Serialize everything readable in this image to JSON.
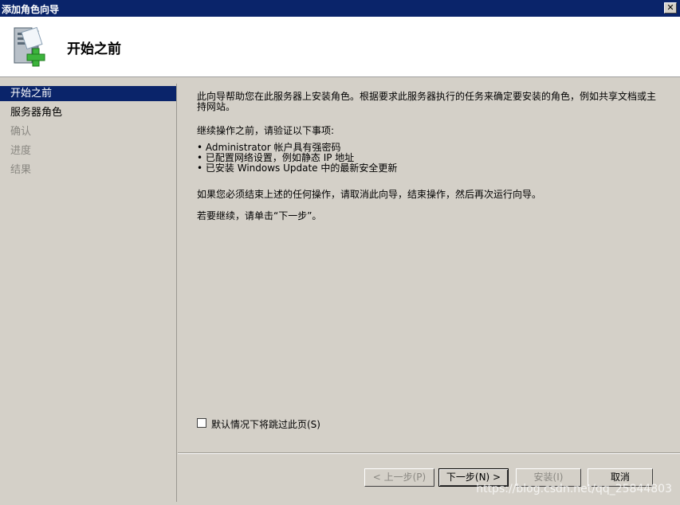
{
  "window": {
    "title": "添加角色向导",
    "close_glyph": "✕"
  },
  "header": {
    "title": "开始之前",
    "icon": "server-add-icon"
  },
  "sidebar": {
    "items": [
      {
        "label": "开始之前",
        "state": "active"
      },
      {
        "label": "服务器角色",
        "state": "enabled"
      },
      {
        "label": "确认",
        "state": "disabled"
      },
      {
        "label": "进度",
        "state": "disabled"
      },
      {
        "label": "结果",
        "state": "disabled"
      }
    ]
  },
  "content": {
    "intro": "此向导帮助您在此服务器上安装角色。根据要求此服务器执行的任务来确定要安装的角色，例如共享文档或主持网站。",
    "verify_heading": "继续操作之前，请验证以下事项:",
    "checklist": [
      "Administrator 帐户具有强密码",
      "已配置网络设置，例如静态 IP 地址",
      "已安装 Windows Update 中的最新安全更新"
    ],
    "cancel_hint": "如果您必须结束上述的任何操作，请取消此向导，结束操作，然后再次运行向导。",
    "continue_hint": "若要继续，请单击“下一步”。"
  },
  "skip_checkbox": {
    "label": "默认情况下将跳过此页(S)",
    "checked": false
  },
  "buttons": {
    "back": "< 上一步(P)",
    "next": "下一步(N) >",
    "install": "安装(I)",
    "cancel": "取消"
  },
  "watermark": "https://blog.csdn.net/qq_25844803",
  "colors": {
    "titlebar": "#0a246a",
    "selection": "#0a246a",
    "face": "#d4d0c8",
    "disabled_text": "#8a8882",
    "icon_plus": "#3cb43c"
  }
}
